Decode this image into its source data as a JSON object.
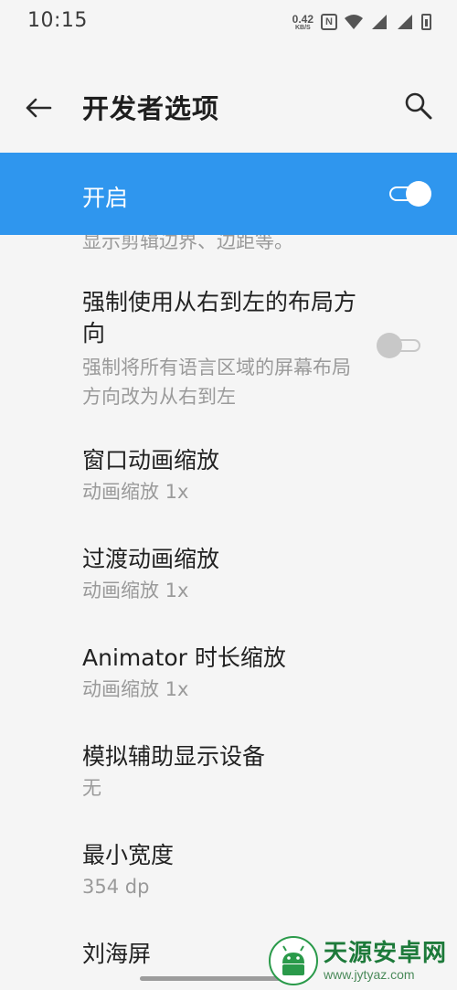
{
  "status_bar": {
    "time": "10:15",
    "net_speed_value": "0.42",
    "net_speed_unit": "KB/S",
    "nfc_label": "N"
  },
  "app_bar": {
    "title": "开发者选项"
  },
  "master": {
    "label": "开启",
    "enabled": true
  },
  "settings": {
    "partial_summary": "显示剪辑边界、边距等。",
    "rtl": {
      "title": "强制使用从右到左的布局方向",
      "summary": "强制将所有语言区域的屏幕布局方向改为从右到左",
      "enabled": false
    },
    "window_anim": {
      "title": "窗口动画缩放",
      "summary": "动画缩放 1x"
    },
    "transition_anim": {
      "title": "过渡动画缩放",
      "summary": "动画缩放 1x"
    },
    "animator_duration": {
      "title": "Animator 时长缩放",
      "summary": "动画缩放 1x"
    },
    "secondary_display": {
      "title": "模拟辅助显示设备",
      "summary": "无"
    },
    "smallest_width": {
      "title": "最小宽度",
      "summary": "354 dp"
    },
    "notch": {
      "title": "刘海屏"
    }
  },
  "watermark": {
    "main": "天源安卓网",
    "url": "www.jytyaz.com"
  },
  "colors": {
    "accent": "#2f96ee",
    "background": "#f5f5f5",
    "summary_text": "#9a9a9a"
  }
}
